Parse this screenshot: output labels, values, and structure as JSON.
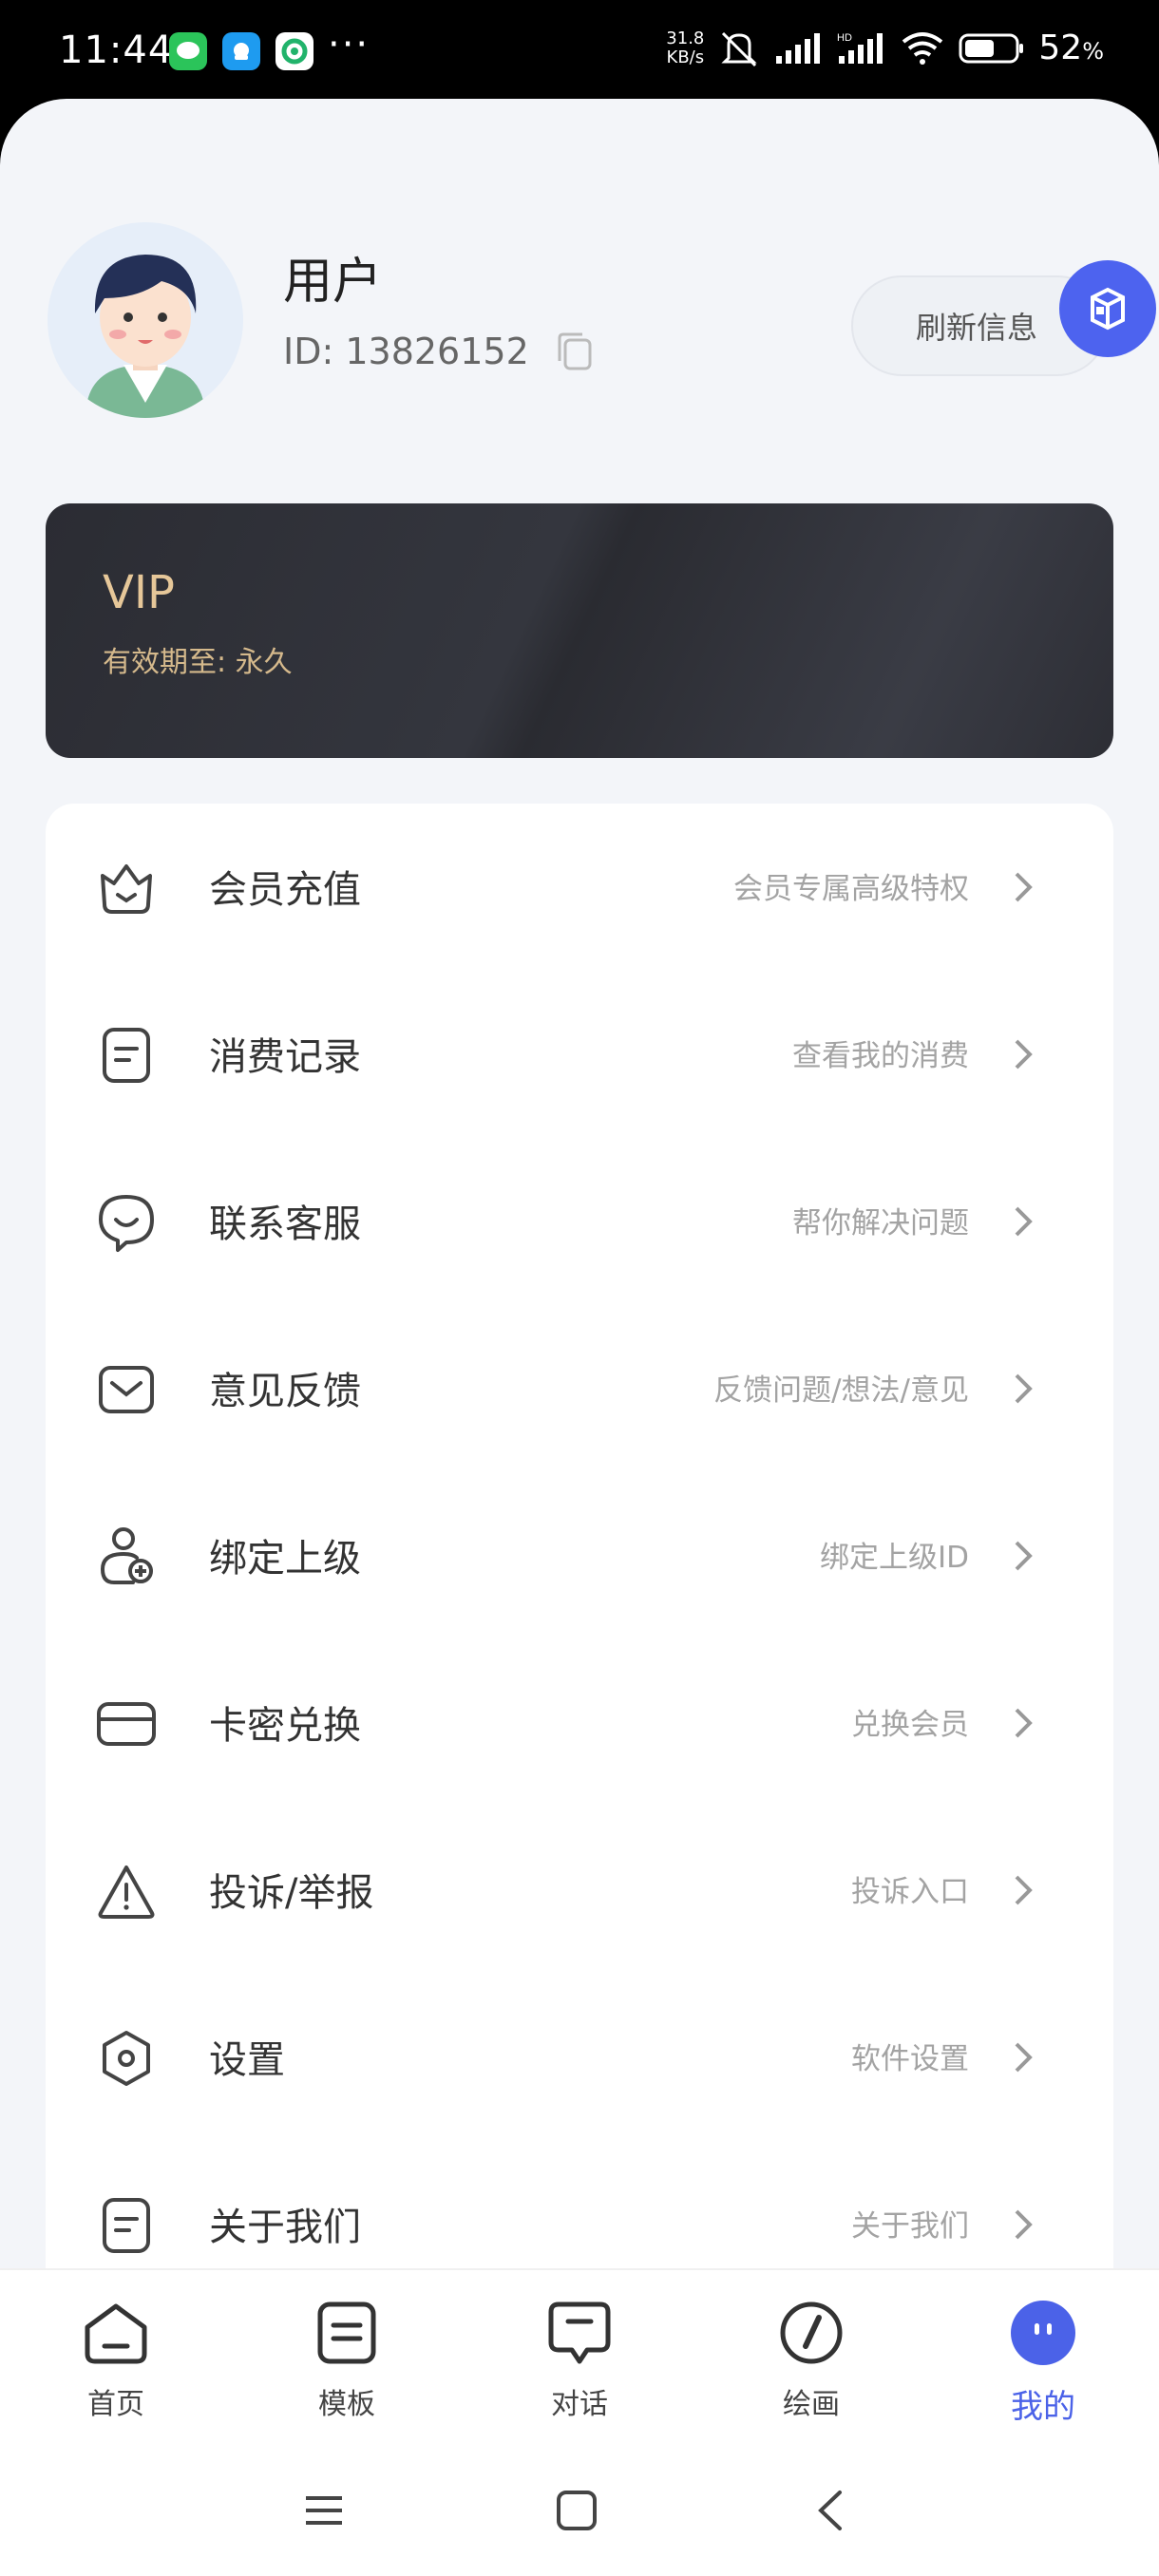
{
  "status_bar": {
    "time": "11:44",
    "speed_top": "31.8",
    "speed_bottom": "KB/s",
    "battery_value": "52",
    "battery_unit": "%",
    "apps": [
      "messages-app-icon",
      "qq-app-icon",
      "browser-app-icon"
    ]
  },
  "profile": {
    "name": "用户",
    "id_text": "ID: 13826152",
    "refresh_label": "刷新信息"
  },
  "vip": {
    "title": "VIP",
    "expire": "有效期至: 永久"
  },
  "menu": [
    {
      "label": "会员充值",
      "sub": "会员专属高级特权",
      "icon": "crown-icon"
    },
    {
      "label": "消费记录",
      "sub": "查看我的消费",
      "icon": "document-icon"
    },
    {
      "label": "联系客服",
      "sub": "帮你解决问题",
      "icon": "chat-bubble-icon"
    },
    {
      "label": "意见反馈",
      "sub": "反馈问题/想法/意见",
      "icon": "mail-icon"
    },
    {
      "label": "绑定上级",
      "sub": "绑定上级ID",
      "icon": "add-user-icon"
    },
    {
      "label": "卡密兑换",
      "sub": "兑换会员",
      "icon": "card-icon"
    },
    {
      "label": "投诉/举报",
      "sub": "投诉入口",
      "icon": "warning-icon"
    },
    {
      "label": "设置",
      "sub": "软件设置",
      "icon": "settings-icon"
    },
    {
      "label": "关于我们",
      "sub": "关于我们",
      "icon": "about-icon"
    }
  ],
  "tabs": [
    {
      "label": "首页",
      "icon": "home-icon"
    },
    {
      "label": "模板",
      "icon": "template-icon"
    },
    {
      "label": "对话",
      "icon": "dialog-icon"
    },
    {
      "label": "绘画",
      "icon": "paint-icon"
    },
    {
      "label": "我的",
      "icon": "profile-icon"
    }
  ],
  "colors": {
    "accent": "#4b62e8",
    "vip_gold": "#e6c799",
    "background": "#f3f5f9"
  }
}
